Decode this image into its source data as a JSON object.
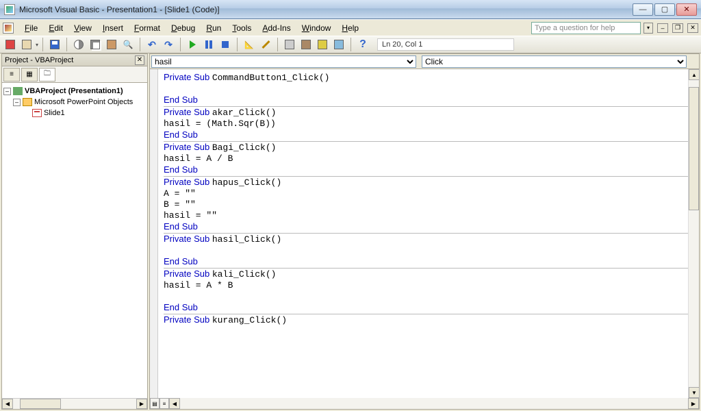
{
  "title": "Microsoft Visual Basic - Presentation1 - [Slide1 (Code)]",
  "menus": [
    "File",
    "Edit",
    "View",
    "Insert",
    "Format",
    "Debug",
    "Run",
    "Tools",
    "Add-Ins",
    "Window",
    "Help"
  ],
  "helpPlaceholder": "Type a question for help",
  "status": "Ln 20, Col 1",
  "project": {
    "paneTitle": "Project - VBAProject",
    "root": "VBAProject (Presentation1)",
    "folder": "Microsoft PowerPoint Objects",
    "item": "Slide1"
  },
  "dropdowns": {
    "object": "hasil",
    "proc": "Click"
  },
  "codeLines": [
    {
      "t": "kw",
      "s": "Private Sub "
    },
    {
      "t": "p",
      "s": "CommandButton1_Click()\n"
    },
    {
      "t": "nl"
    },
    {
      "t": "kw",
      "s": "End Sub\n"
    },
    {
      "t": "hr"
    },
    {
      "t": "kw",
      "s": "Private Sub "
    },
    {
      "t": "p",
      "s": "akar_Click()\n"
    },
    {
      "t": "p",
      "s": "hasil = (Math.Sqr(B))\n"
    },
    {
      "t": "kw",
      "s": "End Sub\n"
    },
    {
      "t": "hr"
    },
    {
      "t": "kw",
      "s": "Private Sub "
    },
    {
      "t": "p",
      "s": "Bagi_Click()\n"
    },
    {
      "t": "p",
      "s": "hasil = A / B\n"
    },
    {
      "t": "kw",
      "s": "End Sub\n"
    },
    {
      "t": "hr"
    },
    {
      "t": "kw",
      "s": "Private Sub "
    },
    {
      "t": "p",
      "s": "hapus_Click()\n"
    },
    {
      "t": "p",
      "s": "A = \"\"\n"
    },
    {
      "t": "p",
      "s": "B = \"\"\n"
    },
    {
      "t": "p",
      "s": "hasil = \"\"\n"
    },
    {
      "t": "kw",
      "s": "End Sub\n"
    },
    {
      "t": "hr"
    },
    {
      "t": "kw",
      "s": "Private Sub "
    },
    {
      "t": "p",
      "s": "hasil_Click()\n"
    },
    {
      "t": "nl"
    },
    {
      "t": "kw",
      "s": "End Sub\n"
    },
    {
      "t": "hr"
    },
    {
      "t": "kw",
      "s": "Private Sub "
    },
    {
      "t": "p",
      "s": "kali_Click()\n"
    },
    {
      "t": "p",
      "s": "hasil = A * B\n"
    },
    {
      "t": "nl"
    },
    {
      "t": "kw",
      "s": "End Sub\n"
    },
    {
      "t": "hr"
    },
    {
      "t": "kw",
      "s": "Private Sub "
    },
    {
      "t": "p",
      "s": "kurang_Click()\n"
    }
  ]
}
